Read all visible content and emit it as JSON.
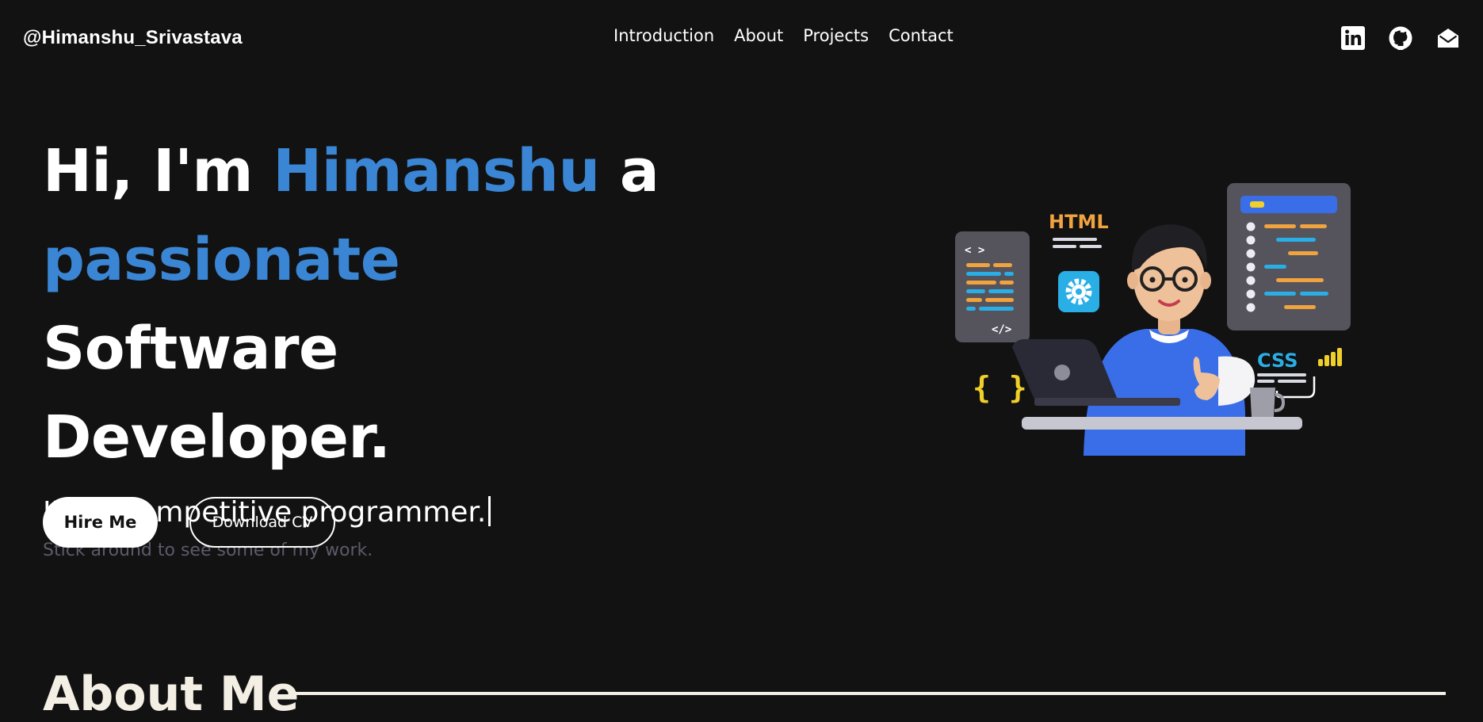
{
  "header": {
    "brand": "@Himanshu_Srivastava",
    "nav": [
      {
        "label": "Introduction"
      },
      {
        "label": "About"
      },
      {
        "label": "Projects"
      },
      {
        "label": "Contact"
      }
    ],
    "social_icons": [
      "linkedin-icon",
      "github-icon",
      "mail-icon"
    ]
  },
  "hero": {
    "line1_a": "Hi, I'm ",
    "line1_name": "Himanshu",
    "line1_b": " a",
    "line2_highlight": "passionate",
    "line2_b": " Software",
    "line3": "Developer.",
    "typed_text": "I'm a competitive programmer.",
    "subtitle": "Stick around to see some of my work.",
    "primary_button": "Hire Me",
    "secondary_button": "Download CV"
  },
  "illustration": {
    "html_label": "HTML",
    "css_label": "CSS",
    "code_open": "< >",
    "code_close": "</>",
    "braces": "{ }"
  },
  "about": {
    "title": "About Me"
  },
  "colors": {
    "background": "#121212",
    "accent": "#3a86d4",
    "text": "#ffffff",
    "muted": "#5b5b6b",
    "about_title": "#f3efe4"
  }
}
